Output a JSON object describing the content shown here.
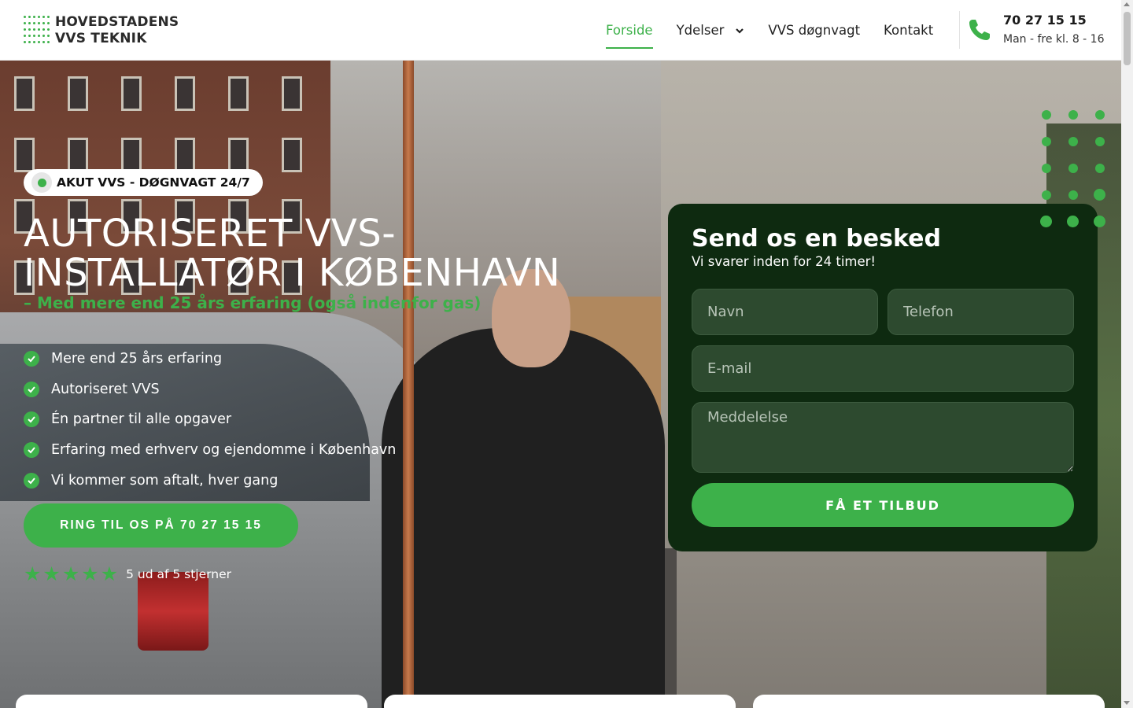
{
  "header": {
    "logo_line1": "HOVEDSTADENS",
    "logo_line2": "VVS TEKNIK",
    "nav": [
      {
        "label": "Forside",
        "active": true
      },
      {
        "label": "Ydelser",
        "has_dropdown": true
      },
      {
        "label": "VVS døgnvagt"
      },
      {
        "label": "Kontakt"
      }
    ],
    "phone_icon": "phone-icon",
    "phone_number": "70 27 15 15",
    "phone_hours": "Man - fre kl. 8 - 16"
  },
  "hero": {
    "badge": "AKUT VVS - DØGNVAGT 24/7",
    "title_line1": "AUTORISERET VVS-",
    "title_line2": "INSTALLATØR I KØBENHAVN",
    "subtitle": "– Med mere end 25 års erfaring (også indenfor gas)",
    "features": [
      "Mere end 25 års erfaring",
      "Autoriseret VVS",
      "Én partner til alle opgaver",
      "Erfaring med erhverv og ejendomme i København",
      "Vi kommer som aftalt, hver gang"
    ],
    "cta_label": "RING TIL OS PÅ 70 27 15 15",
    "rating_stars": 5,
    "rating_text": "5 ud af 5 stjerner"
  },
  "form": {
    "title": "Send os en besked",
    "subtitle": "Vi svarer inden for 24 timer!",
    "name_placeholder": "Navn",
    "phone_placeholder": "Telefon",
    "email_placeholder": "E-mail",
    "message_placeholder": "Meddelelse",
    "submit_label": "FÅ ET TILBUD"
  },
  "colors": {
    "accent": "#3db14a",
    "form_bg": "#0e2a10",
    "field_bg": "#2d4a2f"
  }
}
